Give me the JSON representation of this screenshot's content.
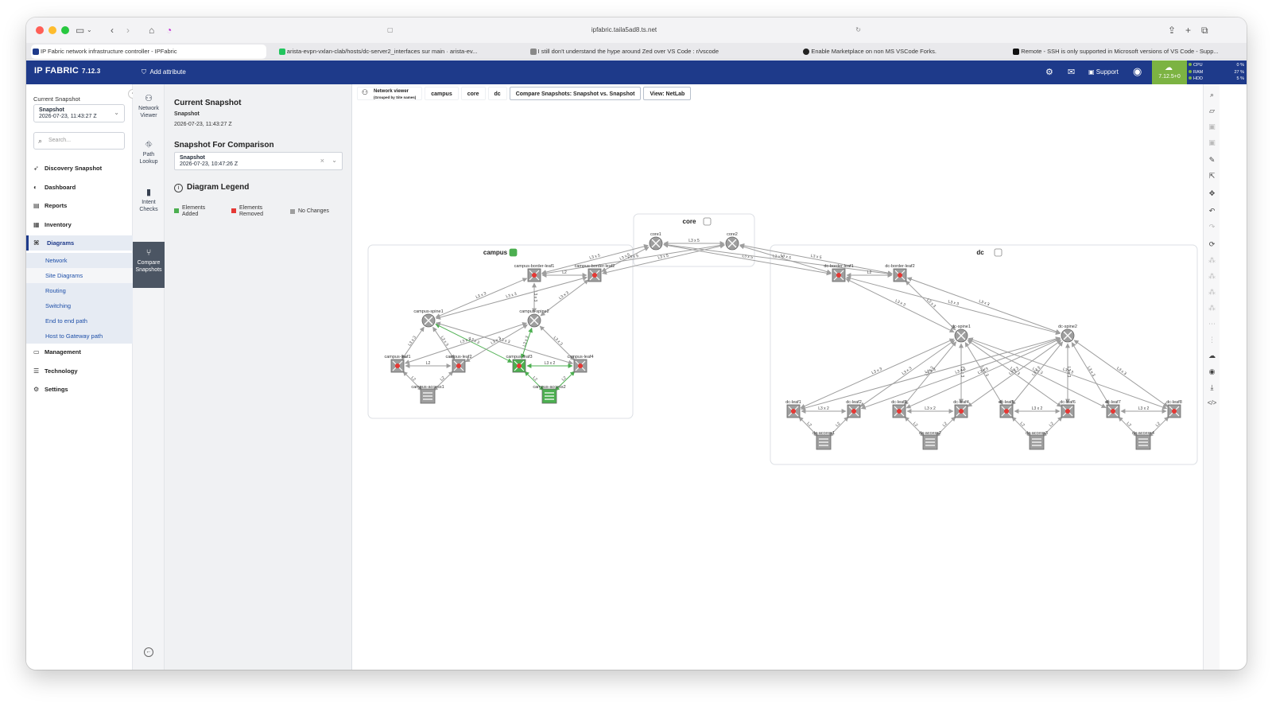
{
  "browser": {
    "url": "ipfabric.taila5ad8.ts.net",
    "tabs": [
      {
        "title": "IP Fabric network infrastructure controller - IPFabric",
        "active": true,
        "color": "#1e3a8a"
      },
      {
        "title": "arista-evpn-vxlan-clab/hosts/dc-server2_interfaces sur main · arista-ev...",
        "active": false,
        "color": "#22c55e"
      },
      {
        "title": "I still don't understand the hype around Zed over VS Code : r/vscode",
        "active": false,
        "color": "#888888"
      },
      {
        "title": "Enable Marketplace on non MS VSCode Forks.",
        "active": false,
        "color": "#222222"
      },
      {
        "title": "Remote - SSH is only supported in Microsoft versions of VS Code - Supp...",
        "active": false,
        "color": "#111111"
      }
    ]
  },
  "app": {
    "brand": "IP FABRIC",
    "version": "7.12.3",
    "add_attribute": "Add attribute",
    "support": "Support",
    "version_badge": "7.12.5+0",
    "stats": [
      {
        "label": "CPU",
        "value": "0 %"
      },
      {
        "label": "RAM",
        "value": "27 %"
      },
      {
        "label": "HDD",
        "value": "5 %"
      }
    ]
  },
  "sidebar": {
    "current_snapshot_label": "Current Snapshot",
    "snapshot_name": "Snapshot",
    "snapshot_time": "2026-07-23, 11:43:27 Z",
    "search_placeholder": "Search...",
    "nav": {
      "discovery": "Discovery Snapshot",
      "dashboard": "Dashboard",
      "reports": "Reports",
      "inventory": "Inventory",
      "diagrams": "Diagrams",
      "management": "Management",
      "technology": "Technology",
      "settings": "Settings"
    },
    "diagram_subs": [
      "Network",
      "Site Diagrams",
      "Routing",
      "Switching",
      "End to end path",
      "Host to Gateway path"
    ]
  },
  "rail": {
    "network_viewer": [
      "Network",
      "Viewer"
    ],
    "path_lookup": [
      "Path",
      "Lookup"
    ],
    "intent_checks": [
      "Intent",
      "Checks"
    ],
    "compare_snapshots": [
      "Compare",
      "Snapshots"
    ]
  },
  "panel": {
    "current_title": "Current Snapshot",
    "current_name": "Snapshot",
    "current_time": "2026-07-23, 11:43:27 Z",
    "comparison_title": "Snapshot For Comparison",
    "comparison_name": "Snapshot",
    "comparison_time": "2026-07-23, 10:47:26 Z",
    "legend_title": "Diagram Legend",
    "legend": {
      "added": [
        "Elements",
        "Added"
      ],
      "removed": [
        "Elements",
        "Removed"
      ],
      "nochange": "No Changes"
    }
  },
  "canvas": {
    "crumb_viewer": "Network viewer",
    "crumb_viewer_sub": "(Grouped by Site names)",
    "crumbs": [
      "campus",
      "core",
      "dc"
    ],
    "compare_view": "Compare Snapshots: Snapshot vs. Snapshot",
    "view_mode": "View: NetLab"
  },
  "colors": {
    "brand": "#1e3a8a",
    "added": "#4caf50",
    "removed": "#e53935",
    "nochange": "#9e9e9e",
    "badge": "#7cb342"
  },
  "diagram": {
    "groups": [
      {
        "name": "campus"
      },
      {
        "name": "core"
      },
      {
        "name": "dc"
      }
    ],
    "nodes": [
      {
        "id": "core1",
        "type": "router",
        "status": "nochange"
      },
      {
        "id": "core2",
        "type": "router",
        "status": "nochange"
      },
      {
        "id": "campus-border-leaf1",
        "type": "switch",
        "status": "nochange"
      },
      {
        "id": "campus-border-leaf2",
        "type": "switch",
        "status": "nochange"
      },
      {
        "id": "campus-spine1",
        "type": "router",
        "status": "nochange"
      },
      {
        "id": "campus-spine2",
        "type": "router",
        "status": "nochange"
      },
      {
        "id": "campus-leaf1",
        "type": "switch",
        "status": "nochange"
      },
      {
        "id": "campus-leaf2",
        "type": "switch",
        "status": "nochange"
      },
      {
        "id": "campus-leaf3",
        "type": "switch",
        "status": "added"
      },
      {
        "id": "campus-leaf4",
        "type": "switch",
        "status": "nochange"
      },
      {
        "id": "campus-access1",
        "type": "l2switch",
        "status": "nochange"
      },
      {
        "id": "campus-access2",
        "type": "l2switch",
        "status": "added"
      },
      {
        "id": "dc-border-leaf1",
        "type": "switch",
        "status": "nochange"
      },
      {
        "id": "dc-border-leaf2",
        "type": "switch",
        "status": "nochange"
      },
      {
        "id": "dc-spine1",
        "type": "router",
        "status": "nochange"
      },
      {
        "id": "dc-spine2",
        "type": "router",
        "status": "nochange"
      },
      {
        "id": "dc-leaf1",
        "type": "switch",
        "status": "nochange"
      },
      {
        "id": "dc-leaf2",
        "type": "switch",
        "status": "nochange"
      },
      {
        "id": "dc-leaf3",
        "type": "switch",
        "status": "nochange"
      },
      {
        "id": "dc-leaf4",
        "type": "switch",
        "status": "nochange"
      },
      {
        "id": "dc-leaf5",
        "type": "switch",
        "status": "nochange"
      },
      {
        "id": "dc-leaf6",
        "type": "switch",
        "status": "nochange"
      },
      {
        "id": "dc-leaf7",
        "type": "switch",
        "status": "nochange"
      },
      {
        "id": "dc-leaf8",
        "type": "switch",
        "status": "nochange"
      },
      {
        "id": "dc-access1",
        "type": "l2switch",
        "status": "nochange"
      },
      {
        "id": "dc-access2",
        "type": "l2switch",
        "status": "nochange"
      },
      {
        "id": "dc-access3",
        "type": "l2switch",
        "status": "nochange"
      },
      {
        "id": "dc-access4",
        "type": "l2switch",
        "status": "nochange"
      }
    ],
    "links": [
      {
        "a": "core1",
        "b": "core2",
        "label": "L3 x 5",
        "status": "nochange"
      },
      {
        "a": "core1",
        "b": "campus-border-leaf1",
        "label": "L3 x 5",
        "status": "nochange"
      },
      {
        "a": "core1",
        "b": "campus-border-leaf2",
        "label": "L3 x 5",
        "status": "nochange"
      },
      {
        "a": "core2",
        "b": "campus-border-leaf1",
        "label": "L3 x 5",
        "status": "nochange"
      },
      {
        "a": "core2",
        "b": "campus-border-leaf2",
        "label": "L3 x 5",
        "status": "nochange"
      },
      {
        "a": "core1",
        "b": "dc-border-leaf1",
        "label": "L3 x 5",
        "status": "nochange"
      },
      {
        "a": "core1",
        "b": "dc-border-leaf2",
        "label": "L3 x 5",
        "status": "nochange"
      },
      {
        "a": "core2",
        "b": "dc-border-leaf1",
        "label": "L3 x 5",
        "status": "nochange"
      },
      {
        "a": "core2",
        "b": "dc-border-leaf2",
        "label": "L3 x 5",
        "status": "nochange"
      },
      {
        "a": "campus-border-leaf1",
        "b": "campus-border-leaf2",
        "label": "L2",
        "status": "nochange"
      },
      {
        "a": "campus-border-leaf1",
        "b": "campus-spine1",
        "label": "L3 x 3",
        "status": "nochange"
      },
      {
        "a": "campus-border-leaf1",
        "b": "campus-spine2",
        "label": "L3 x 3",
        "status": "nochange"
      },
      {
        "a": "campus-border-leaf2",
        "b": "campus-spine1",
        "label": "L3 x 3",
        "status": "nochange"
      },
      {
        "a": "campus-border-leaf2",
        "b": "campus-spine2",
        "label": "L3 x 3",
        "status": "nochange"
      },
      {
        "a": "campus-spine1",
        "b": "campus-leaf1",
        "label": "L3 x 3",
        "status": "nochange"
      },
      {
        "a": "campus-spine1",
        "b": "campus-leaf2",
        "label": "L3 x 3",
        "status": "nochange"
      },
      {
        "a": "campus-spine1",
        "b": "campus-leaf3",
        "label": "L3 x 3",
        "status": "added"
      },
      {
        "a": "campus-spine1",
        "b": "campus-leaf4",
        "label": "L3 x 3",
        "status": "nochange"
      },
      {
        "a": "campus-spine2",
        "b": "campus-leaf1",
        "label": "L3 x 3",
        "status": "nochange"
      },
      {
        "a": "campus-spine2",
        "b": "campus-leaf2",
        "label": "L3 x 3",
        "status": "nochange"
      },
      {
        "a": "campus-spine2",
        "b": "campus-leaf3",
        "label": "L3 x 3",
        "status": "added"
      },
      {
        "a": "campus-spine2",
        "b": "campus-leaf4",
        "label": "L3 x 3",
        "status": "nochange"
      },
      {
        "a": "campus-leaf1",
        "b": "campus-leaf2",
        "label": "L2",
        "status": "nochange"
      },
      {
        "a": "campus-leaf3",
        "b": "campus-leaf4",
        "label": "L3 x 2",
        "status": "added"
      },
      {
        "a": "campus-leaf1",
        "b": "campus-access1",
        "label": "L2",
        "status": "nochange"
      },
      {
        "a": "campus-leaf2",
        "b": "campus-access1",
        "label": "L2",
        "status": "nochange"
      },
      {
        "a": "campus-leaf3",
        "b": "campus-access2",
        "label": "L2",
        "status": "added"
      },
      {
        "a": "campus-leaf4",
        "b": "campus-access2",
        "label": "L2",
        "status": "added"
      },
      {
        "a": "dc-border-leaf1",
        "b": "dc-border-leaf2",
        "label": "L2",
        "status": "nochange"
      },
      {
        "a": "dc-border-leaf1",
        "b": "dc-spine1",
        "label": "L3 x 3",
        "status": "nochange"
      },
      {
        "a": "dc-border-leaf1",
        "b": "dc-spine2",
        "label": "L3 x 3",
        "status": "nochange"
      },
      {
        "a": "dc-border-leaf2",
        "b": "dc-spine1",
        "label": "L3 x 3",
        "status": "nochange"
      },
      {
        "a": "dc-border-leaf2",
        "b": "dc-spine2",
        "label": "L3 x 3",
        "status": "nochange"
      },
      {
        "a": "dc-spine1",
        "b": "dc-leaf1",
        "label": "L3 x 3",
        "status": "nochange"
      },
      {
        "a": "dc-spine1",
        "b": "dc-leaf2",
        "label": "L3 x 3",
        "status": "nochange"
      },
      {
        "a": "dc-spine1",
        "b": "dc-leaf3",
        "label": "L3 x 3",
        "status": "nochange"
      },
      {
        "a": "dc-spine1",
        "b": "dc-leaf4",
        "label": "L3 x 3",
        "status": "nochange"
      },
      {
        "a": "dc-spine1",
        "b": "dc-leaf5",
        "label": "L3 x 3",
        "status": "nochange"
      },
      {
        "a": "dc-spine1",
        "b": "dc-leaf6",
        "label": "L3 x 3",
        "status": "nochange"
      },
      {
        "a": "dc-spine1",
        "b": "dc-leaf7",
        "label": "L3 x 3",
        "status": "nochange"
      },
      {
        "a": "dc-spine1",
        "b": "dc-leaf8",
        "label": "L3 x 3",
        "status": "nochange"
      },
      {
        "a": "dc-spine2",
        "b": "dc-leaf1",
        "label": "L3 x 3",
        "status": "nochange"
      },
      {
        "a": "dc-spine2",
        "b": "dc-leaf2",
        "label": "L3 x 3",
        "status": "nochange"
      },
      {
        "a": "dc-spine2",
        "b": "dc-leaf3",
        "label": "L3 x 3",
        "status": "nochange"
      },
      {
        "a": "dc-spine2",
        "b": "dc-leaf4",
        "label": "L3 x 3",
        "status": "nochange"
      },
      {
        "a": "dc-spine2",
        "b": "dc-leaf5",
        "label": "L3 x 3",
        "status": "nochange"
      },
      {
        "a": "dc-spine2",
        "b": "dc-leaf6",
        "label": "L3 x 3",
        "status": "nochange"
      },
      {
        "a": "dc-spine2",
        "b": "dc-leaf7",
        "label": "L3 x 3",
        "status": "nochange"
      },
      {
        "a": "dc-spine2",
        "b": "dc-leaf8",
        "label": "L3 x 3",
        "status": "nochange"
      },
      {
        "a": "dc-leaf1",
        "b": "dc-leaf2",
        "label": "L3 x 2",
        "status": "nochange"
      },
      {
        "a": "dc-leaf3",
        "b": "dc-leaf4",
        "label": "L3 x 2",
        "status": "nochange"
      },
      {
        "a": "dc-leaf5",
        "b": "dc-leaf6",
        "label": "L3 x 2",
        "status": "nochange"
      },
      {
        "a": "dc-leaf7",
        "b": "dc-leaf8",
        "label": "L3 x 2",
        "status": "nochange"
      },
      {
        "a": "dc-leaf1",
        "b": "dc-access1",
        "label": "L2",
        "status": "nochange"
      },
      {
        "a": "dc-leaf2",
        "b": "dc-access1",
        "label": "L2",
        "status": "nochange"
      },
      {
        "a": "dc-leaf3",
        "b": "dc-access2",
        "label": "L2",
        "status": "nochange"
      },
      {
        "a": "dc-leaf4",
        "b": "dc-access2",
        "label": "L2",
        "status": "nochange"
      },
      {
        "a": "dc-leaf5",
        "b": "dc-access3",
        "label": "L2",
        "status": "nochange"
      },
      {
        "a": "dc-leaf6",
        "b": "dc-access3",
        "label": "L2",
        "status": "nochange"
      },
      {
        "a": "dc-leaf7",
        "b": "dc-access4",
        "label": "L2",
        "status": "nochange"
      },
      {
        "a": "dc-leaf8",
        "b": "dc-access4",
        "label": "L2",
        "status": "nochange"
      }
    ]
  }
}
